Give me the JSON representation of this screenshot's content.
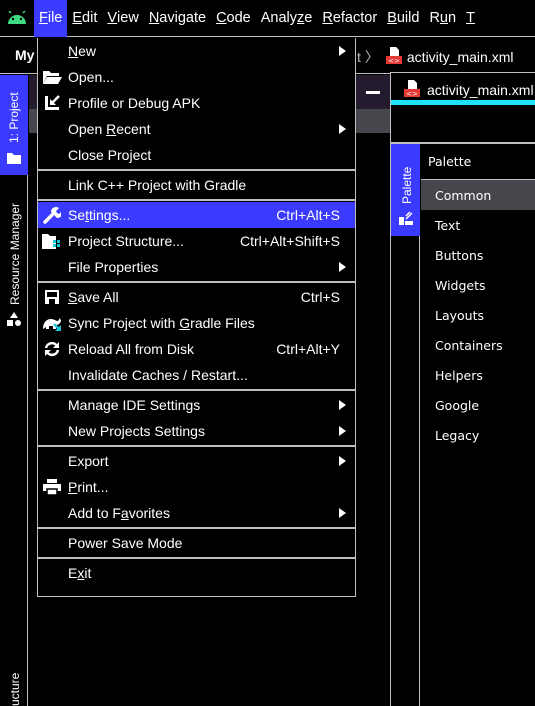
{
  "menubar": {
    "logo_icon": "android-icon",
    "items": [
      {
        "label": "File",
        "mnemonic_index": 0,
        "active": true
      },
      {
        "label": "Edit",
        "mnemonic_index": 0
      },
      {
        "label": "View",
        "mnemonic_index": 0
      },
      {
        "label": "Navigate",
        "mnemonic_index": 0
      },
      {
        "label": "Code",
        "mnemonic_index": 0
      },
      {
        "label": "Analyze",
        "mnemonic_index": 5
      },
      {
        "label": "Refactor",
        "mnemonic_index": 0
      },
      {
        "label": "Build",
        "mnemonic_index": 0
      },
      {
        "label": "Run",
        "mnemonic_index": 1
      },
      {
        "label": "T",
        "mnemonic_index": 0
      }
    ]
  },
  "navbar": {
    "project_name": "My",
    "breadcrumb_partial": "t",
    "breadcrumb_separator": "〉",
    "file": "activity_main.xml"
  },
  "left_strip": {
    "project_tab": "1: Project",
    "resource_manager": "Resource Manager",
    "structure_partial": "ucture"
  },
  "editor": {
    "tab_label": "activity_main.xml",
    "accent_color": "#1ee3ff"
  },
  "palette": {
    "tab_label": "Palette",
    "title": "Palette",
    "items": [
      "Common",
      "Text",
      "Buttons",
      "Widgets",
      "Layouts",
      "Containers",
      "Helpers",
      "Google",
      "Legacy"
    ],
    "selected": "Common"
  },
  "file_menu": {
    "highlight_color": "#3b3bff",
    "groups": [
      [
        {
          "label": "New",
          "underline": 0,
          "submenu": true
        },
        {
          "label": "Open...",
          "icon": "folder-open-icon"
        },
        {
          "label": "Profile or Debug APK",
          "icon": "import-arrow-icon"
        },
        {
          "label": "Open Recent",
          "underline": 5,
          "submenu": true
        },
        {
          "label": "Close Project"
        }
      ],
      [
        {
          "label": "Link C++ Project with Gradle"
        }
      ],
      [
        {
          "label": "Settings...",
          "icon": "wrench-icon",
          "shortcut": "Ctrl+Alt+S",
          "underline": 2,
          "highlighted": true
        },
        {
          "label": "Project Structure...",
          "icon": "project-structure-icon",
          "shortcut": "Ctrl+Alt+Shift+S"
        },
        {
          "label": "File Properties",
          "submenu": true
        }
      ],
      [
        {
          "label": "Save All",
          "icon": "save-icon",
          "shortcut": "Ctrl+S",
          "underline": 0
        },
        {
          "label": "Sync Project with Gradle Files",
          "icon": "gradle-sync-icon",
          "underline": 18
        },
        {
          "label": "Reload All from Disk",
          "icon": "reload-icon",
          "shortcut": "Ctrl+Alt+Y"
        },
        {
          "label": "Invalidate Caches / Restart..."
        }
      ],
      [
        {
          "label": "Manage IDE Settings",
          "submenu": true
        },
        {
          "label": "New Projects Settings",
          "submenu": true
        }
      ],
      [
        {
          "label": "Export",
          "submenu": true
        },
        {
          "label": "Print...",
          "icon": "printer-icon",
          "underline": 0
        },
        {
          "label": "Add to Favorites",
          "underline": 8,
          "submenu": true
        }
      ],
      [
        {
          "label": "Power Save Mode"
        }
      ],
      [
        {
          "label": "Exit",
          "underline": 1
        }
      ]
    ]
  }
}
